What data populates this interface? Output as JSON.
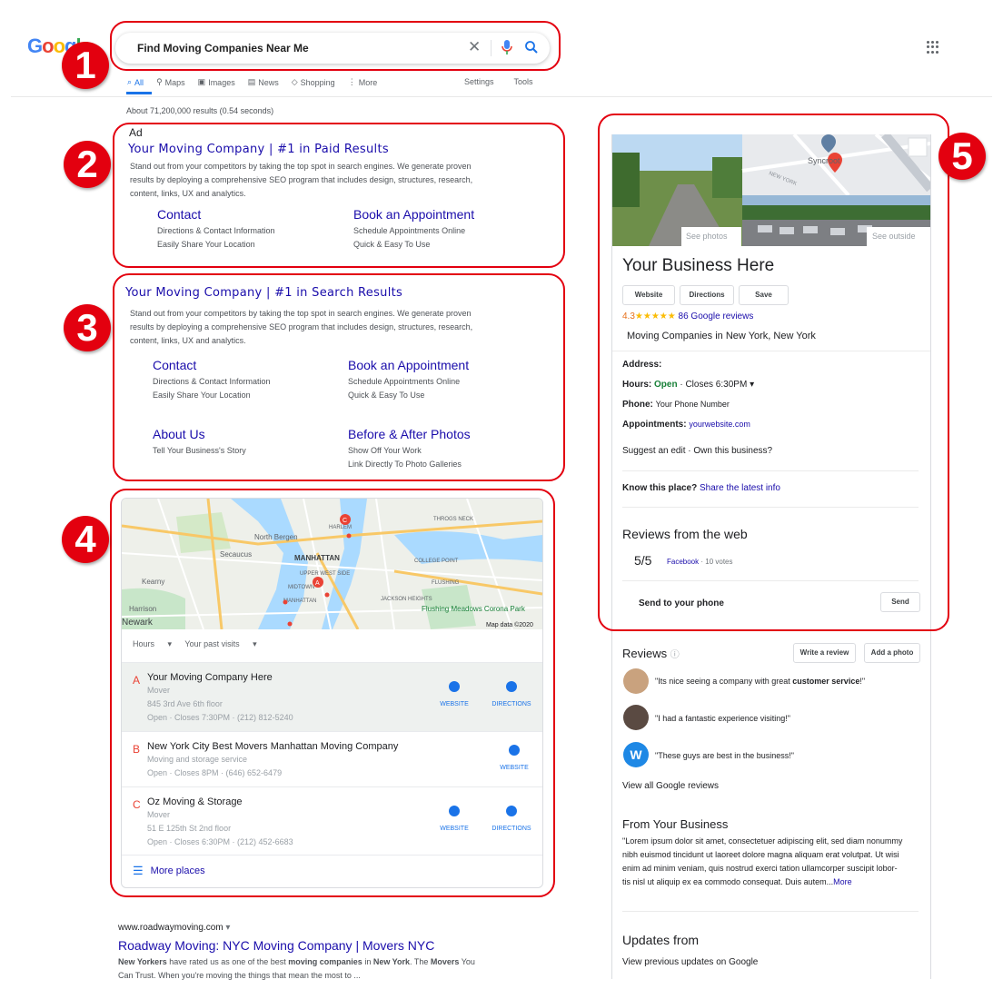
{
  "header": {
    "logo": [
      "G",
      "o",
      "o",
      "g",
      "l",
      "e"
    ],
    "query": "Find Moving Companies Near Me",
    "tabs": [
      {
        "label": "All",
        "icon": "search-icon",
        "active": true
      },
      {
        "label": "Maps",
        "icon": "pin-icon"
      },
      {
        "label": "Images",
        "icon": "image-icon"
      },
      {
        "label": "News",
        "icon": "news-icon"
      },
      {
        "label": "Shopping",
        "icon": "tag-icon"
      },
      {
        "label": "More",
        "icon": "dots-icon"
      }
    ],
    "settings": "Settings",
    "tools": "Tools",
    "stats": "About 71,200,000 results (0.54 seconds)"
  },
  "badges": [
    "1",
    "2",
    "3",
    "4",
    "5"
  ],
  "ad": {
    "label": "Ad",
    "title": "Your Moving Company | #1 in Paid Results",
    "desc1": "Stand out from your competitors by taking the top spot in search engines. We generate proven",
    "desc2": "results by deploying a comprehensive SEO program that includes design, structures, research,",
    "desc3": "content, links, UX and analytics.",
    "links": [
      {
        "title": "Contact",
        "l1": "Directions & Contact Information",
        "l2": "Easily Share Your Location"
      },
      {
        "title": "Book an Appointment",
        "l1": "Schedule Appointments Online",
        "l2": "Quick & Easy To Use"
      }
    ]
  },
  "organic": {
    "title": "Your Moving Company | #1 in Search Results",
    "desc1": "Stand out from your competitors by taking the top spot in search engines. We generate proven",
    "desc2": "results by deploying a comprehensive SEO program that includes design, structures, research,",
    "desc3": "content, links, UX and analytics.",
    "links": [
      {
        "title": "Contact",
        "l1": "Directions & Contact Information",
        "l2": "Easily Share Your Location"
      },
      {
        "title": "Book an Appointment",
        "l1": "Schedule Appointments Online",
        "l2": "Quick & Easy To Use"
      },
      {
        "title": "About Us",
        "l1": "Tell Your Business's Story",
        "l2": ""
      },
      {
        "title": "Before & After Photos",
        "l1": "Show Off Your Work",
        "l2": "Link Directly To Photo Galleries"
      }
    ]
  },
  "map": {
    "labels": [
      "North Bergen",
      "Secaucus",
      "MANHATTAN",
      "UPPER WEST SIDE",
      "MIDTOWN",
      "MANHATTAN",
      "HARLEM",
      "COLLEGE POINT",
      "FLUSHING",
      "JACKSON HEIGHTS",
      "Flushing Meadows Corona Park",
      "Kearny",
      "Harrison",
      "Newark",
      "THROGS NECK"
    ],
    "credit": "Map data ©2020",
    "filters": [
      "Hours",
      "Your past visits"
    ],
    "places": [
      {
        "letter": "A",
        "name": "Your Moving Company Here",
        "type": "Mover",
        "addr": "845 3rd Ave 6th floor",
        "hours": "Open · Closes 7:30PM · (212) 812-5240",
        "btns": [
          "WEBSITE",
          "DIRECTIONS"
        ]
      },
      {
        "letter": "B",
        "name": "New York City Best Movers Manhattan Moving Company",
        "type": "Moving and storage service",
        "addr": "",
        "hours": "Open · Closes 8PM · (646) 652-6479",
        "btns": [
          "WEBSITE"
        ]
      },
      {
        "letter": "C",
        "name": "Oz Moving & Storage",
        "type": "Mover",
        "addr": "51 E 125th St 2nd floor",
        "hours": "Open · Closes 6:30PM · (212) 452-6683",
        "btns": [
          "WEBSITE",
          "DIRECTIONS"
        ]
      }
    ],
    "more": "More places"
  },
  "roadway": {
    "url": "www.roadwaymoving.com",
    "title": "Roadway Moving: NYC Moving Company | Movers NYC",
    "d1a": "New Yorkers",
    "d1b": " have rated us as one of the best ",
    "d1c": "moving companies",
    "d1d": " in ",
    "d1e": "New York",
    "d1f": ". The ",
    "d1g": "Movers",
    "d1h": " You",
    "d2": "Can Trust. When you're moving the things that mean the most to ..."
  },
  "kp": {
    "see_photos": "See photos",
    "see_outside": "See outside",
    "map_label": "Syncroot",
    "road_label": "NEW YORK",
    "name": "Your Business Here",
    "btns": [
      "Website",
      "Directions",
      "Save"
    ],
    "rating": "4.3",
    "stars": "★★★★★",
    "reviews": "86 Google reviews",
    "category": "Moving Companies in New York, New York",
    "address_label": "Address:",
    "hours_label": "Hours:",
    "hours_open": "Open",
    "hours_rest": " · Closes 6:30PM",
    "phone_label": "Phone:",
    "phone": "Your Phone Number",
    "appt_label": "Appointments:",
    "appt": "yourwebsite.com",
    "suggest": "Suggest an edit · Own this business?",
    "know": "Know this place?",
    "share": "Share the latest info",
    "rfw": "Reviews from the web",
    "score": "5/5",
    "source": "Facebook",
    "votes": "· 10 votes",
    "send": "Send to your phone",
    "send_btn": "Send",
    "reviews_h": "Reviews",
    "write": "Write a review",
    "add_photo": "Add a photo",
    "r1a": "\"Its nice seeing a company with great ",
    "r1b": "customer service",
    "r1c": "!\"",
    "r2": "\"I had a fantastic experience visiting!\"",
    "r3": "\"These guys are best in the business!\"",
    "w": "W",
    "view_all": "View all Google reviews",
    "from_h": "From Your Business",
    "lorem1": "\"Lorem ipsum dolor sit amet, consectetuer adipiscing elit, sed diam nonummy",
    "lorem2": "nibh euismod tincidunt ut laoreet dolore magna aliquam erat volutpat. Ut wisi",
    "lorem3": "enim ad minim veniam, quis nostrud exerci tation ullamcorper suscipit lobor-",
    "lorem4": "tis nisl ut aliquip ex ea commodo consequat. Duis autem...",
    "more": "More",
    "updates_h": "Updates from",
    "prev": "View previous updates on Google"
  }
}
